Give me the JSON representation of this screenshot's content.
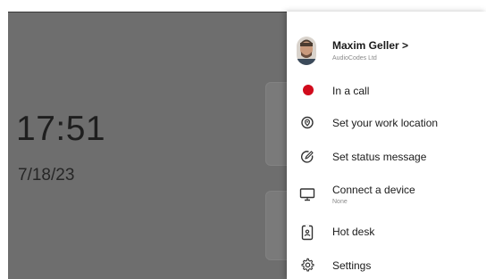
{
  "clock": {
    "time": "17:51",
    "date": "7/18/23"
  },
  "profile": {
    "name": "Maxim Geller",
    "chevron": ">",
    "company": "AudioCodes Ltd"
  },
  "menu": {
    "status_label": "In a call",
    "status_color": "#d10b1c",
    "work_location_label": "Set your work location",
    "status_message_label": "Set status message",
    "connect_device_label": "Connect a device",
    "connect_device_sub": "None",
    "hot_desk_label": "Hot desk",
    "settings_label": "Settings"
  },
  "icons": {
    "avatar": "avatar-photo",
    "status": "status-dot-icon",
    "location": "location-pin-icon",
    "status_message": "pencil-circle-icon",
    "device": "monitor-icon",
    "hot_desk": "badge-icon",
    "settings": "gear-icon"
  },
  "colors": {
    "background": "#6e6e6e",
    "panel": "#ffffff",
    "clock_text": "#1e1e1e"
  }
}
